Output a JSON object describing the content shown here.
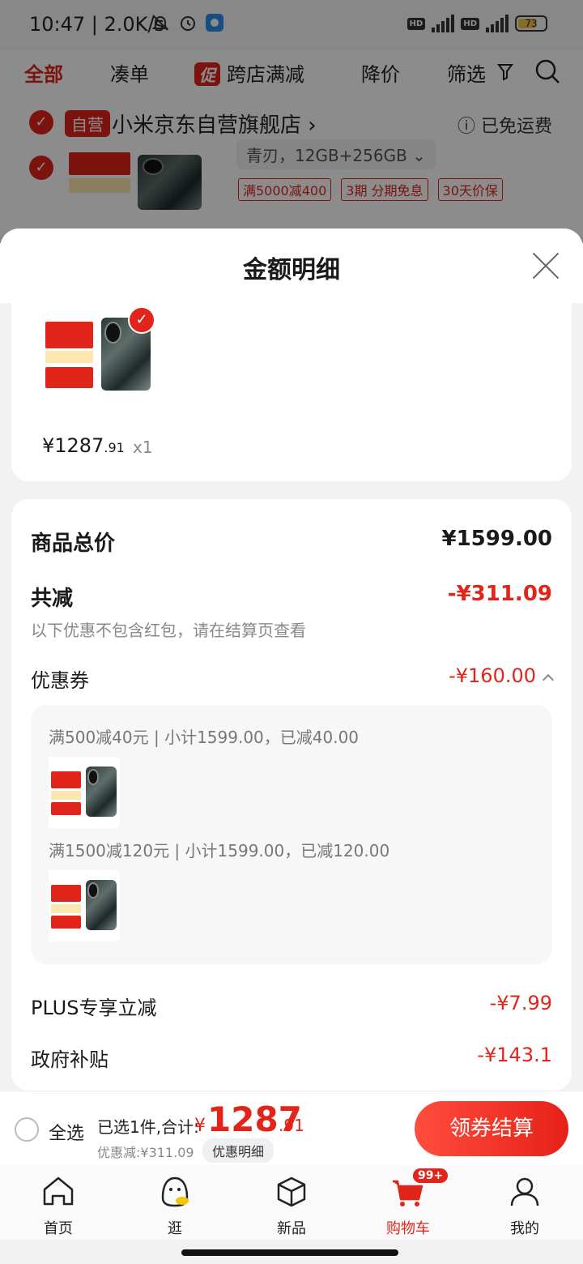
{
  "status_bar": {
    "time": "10:47",
    "net_speed": "2.0K/s",
    "hd1": "HD",
    "hd2": "HD",
    "battery": "73",
    "battery_level": 0.73
  },
  "bg_page": {
    "tabs": [
      "全部",
      "凑单",
      "跨店满减",
      "降价",
      "筛选"
    ],
    "promo_badge": "促",
    "self_tag": "自营",
    "store_name": "小米京东自营旗舰店 ›",
    "free_ship": "ⓘ 已免运费",
    "spec": "青刃，12GB+256GB ⌄",
    "tags": [
      "满5000减400",
      "3期 分期免息",
      "30天价保"
    ]
  },
  "sheet": {
    "title": "金额明细",
    "item": {
      "price_int": "¥1287",
      "price_dec": ".91",
      "qty": "x1"
    },
    "total_label": "商品总价",
    "total_value": "¥1599.00",
    "reduce_label": "共减",
    "reduce_value": "-¥311.09",
    "reduce_note": "以下优惠不包含红包，请在结算页查看",
    "coupon_label": "优惠券",
    "coupon_value": "-¥160.00",
    "coupon_lines": [
      "满500减40元 | 小计1599.00，已减40.00",
      "满1500减120元 | 小计1599.00，已减120.00"
    ],
    "plus_label": "PLUS专享立减",
    "plus_value": "-¥7.99",
    "gov_label": "政府补贴",
    "gov_value": "-¥143.1"
  },
  "checkout": {
    "select_all": "全选",
    "summary": "已选1件,合计:",
    "currency": "¥",
    "total_int": "1287",
    "total_dec": ".91",
    "discount": "优惠减:¥311.09",
    "detail_link": "优惠明细",
    "button": "领券结算"
  },
  "tab_bar": {
    "items": [
      "首页",
      "逛",
      "新品",
      "购物车",
      "我的"
    ],
    "cart_badge": "99+"
  }
}
